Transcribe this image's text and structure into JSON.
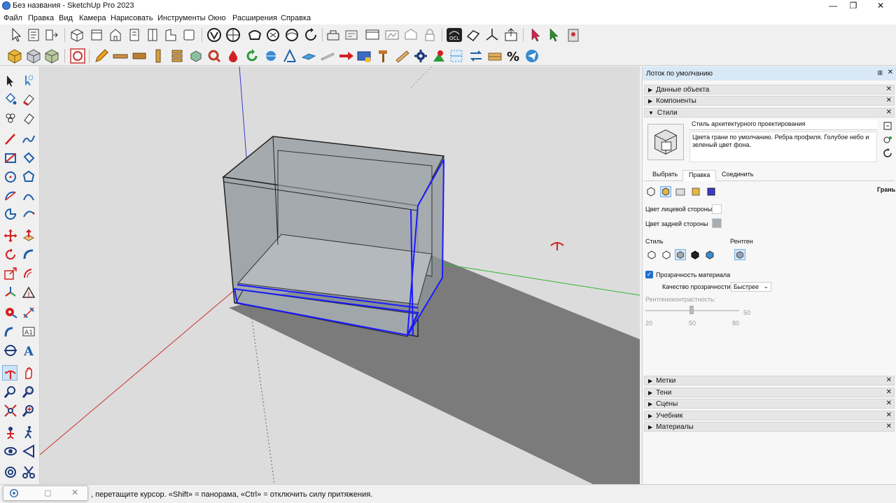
{
  "window": {
    "title": "Без названия - SketchUp Pro 2023",
    "minimize": "—",
    "maximize": "❐",
    "close": "✕"
  },
  "menu": [
    "Файл",
    "Правка",
    "Вид",
    "Камера",
    "Нарисовать",
    "Инструменты",
    "Окно",
    "Расширения",
    "Справка"
  ],
  "toolbar_icons": {
    "row1": [
      "select-arrow-icon",
      "component-icon",
      "section-plane-icon",
      "iso-view-icon",
      "top-view-icon",
      "front-view-icon",
      "right-view-icon",
      "back-view-icon",
      "left-view-icon",
      "bottom-view-icon",
      "xray-icon",
      "wireframe-icon",
      "hidden-line-icon",
      "shaded-icon",
      "textured-icon",
      "monochrome-icon",
      "extension-icon",
      "layout-icon",
      "style-builder-icon",
      "photo-match-icon",
      "warehouse-icon",
      "ocl-icon",
      "add-location-icon",
      "axes-icon",
      "export-icon",
      "arrow-red-icon",
      "arrow-green-icon",
      "plugin-icon"
    ],
    "row2": [
      "solid-cube-icon",
      "translucent-cube-icon",
      "texture-cube-icon",
      "dynamic-component-icon",
      "pencil-icon",
      "plank-icon",
      "board-icon",
      "post-icon",
      "stack-icon",
      "box-icon",
      "ring-icon",
      "paint-drop-icon",
      "rotate-icon",
      "sphere-icon",
      "dimension-icon",
      "panel-icon",
      "cut-icon",
      "arrow-red-block-icon",
      "joint-icon",
      "hammer-icon",
      "saw-icon",
      "gear-icon",
      "plant-icon",
      "bounds-icon",
      "swap-icon",
      "wood-icon",
      "percent-icon",
      "send-icon"
    ]
  },
  "tray": {
    "title": "Лоток по умолчанию",
    "pin": "⊞",
    "close": "✕",
    "panels_top": [
      "Данные объекта",
      "Компоненты",
      "Стили"
    ],
    "style_name": "Стиль архитектурного проектирования",
    "style_desc": "Цвета грани по умолчанию. Ребра профиля. Голубое небо и зеленый цвет фона.",
    "tabs": [
      "Выбрать",
      "Правка",
      "Соединить"
    ],
    "active_tab": "Правка",
    "edit_section": "Грань",
    "face_color_label": "Цвет лицевой стороны",
    "back_color_label": "Цвет задней стороны",
    "face_color": "#ffffff",
    "back_color": "#a7aeb3",
    "style_label": "Стиль",
    "xray_label": "Рентген",
    "transparency_label": "Прозрачность материала",
    "transparency_checked": true,
    "quality_label": "Качество прозрачности:",
    "quality_value": "Быстрее",
    "xray_contrast_label": "Рентгеноконтрастность:",
    "slider_value": "50",
    "slider_ticks": [
      "20",
      "50",
      "80"
    ],
    "panels_bottom": [
      "Метки",
      "Тени",
      "Сцены",
      "Учебник",
      "Материалы"
    ]
  },
  "status": {
    "text": ", перетащите курсор. «Shift» = панорама, «Ctrl» = отключить силу притяжения."
  },
  "colors": {
    "selection": "#1a1aff",
    "axis_red": "#cc2b2b",
    "axis_green": "#2fb52f",
    "axis_blue": "#3a3ad0",
    "tray_header": "#d9e8f6"
  }
}
